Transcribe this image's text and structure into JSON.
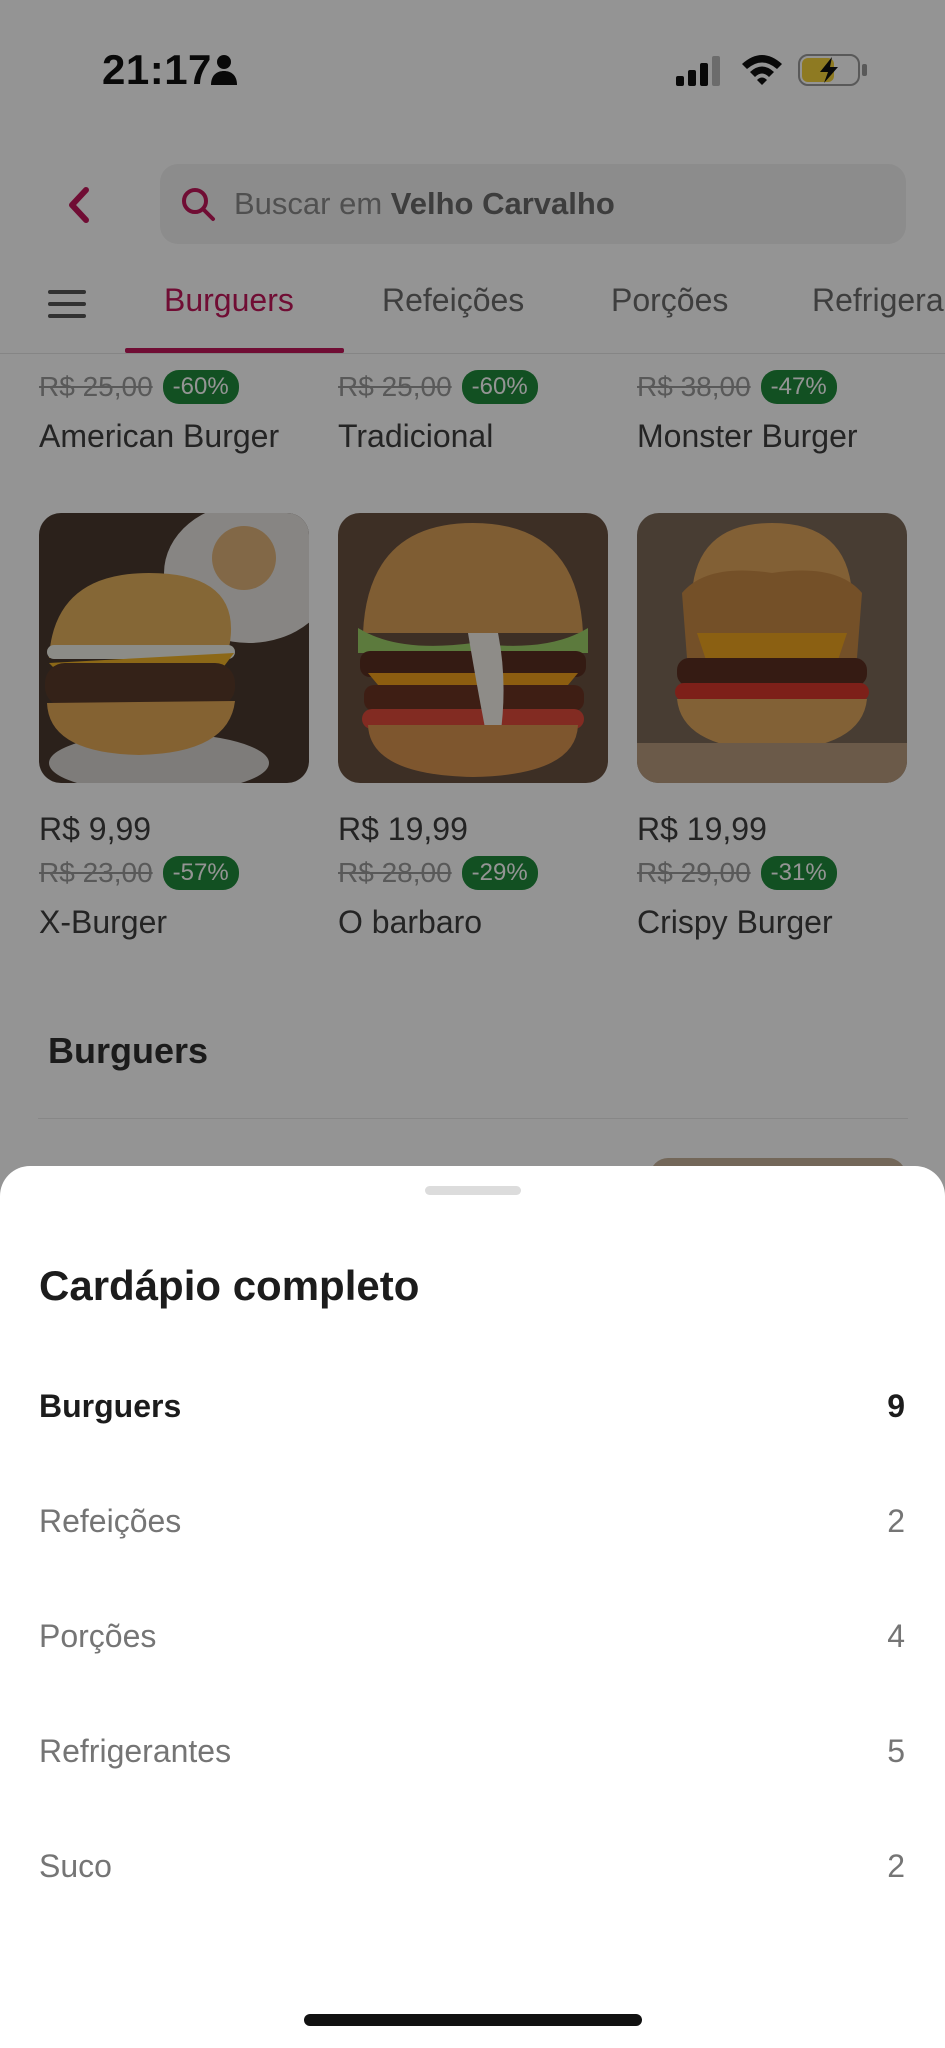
{
  "status_bar": {
    "time": "21:17"
  },
  "header": {
    "search_prefix": "Buscar em",
    "search_store": "Velho Carvalho"
  },
  "tabs": [
    {
      "label": "Burguers",
      "active": true
    },
    {
      "label": "Refeições"
    },
    {
      "label": "Porções"
    },
    {
      "label": "Refrigerantes"
    }
  ],
  "products_row1": [
    {
      "old_price": "R$ 25,00",
      "discount": "-60%",
      "name": "American Burger"
    },
    {
      "old_price": "R$ 25,00",
      "discount": "-60%",
      "name": "Tradicional"
    },
    {
      "old_price": "R$ 38,00",
      "discount": "-47%",
      "name": "Monster Burger"
    }
  ],
  "products_row2": [
    {
      "price": "R$ 9,99",
      "old_price": "R$ 23,00",
      "discount": "-57%",
      "name": "X-Burger"
    },
    {
      "price": "R$ 19,99",
      "old_price": "R$ 28,00",
      "discount": "-29%",
      "name": "O barbaro"
    },
    {
      "price": "R$ 19,99",
      "old_price": "R$ 29,00",
      "discount": "-31%",
      "name": "Crispy Burger"
    }
  ],
  "section": {
    "title": "Burguers"
  },
  "sheet": {
    "title": "Cardápio completo",
    "categories": [
      {
        "label": "Burguers",
        "count": "9",
        "active": true
      },
      {
        "label": "Refeições",
        "count": "2"
      },
      {
        "label": "Porções",
        "count": "4"
      },
      {
        "label": "Refrigerantes",
        "count": "5"
      },
      {
        "label": "Suco",
        "count": "2"
      }
    ]
  },
  "colors": {
    "accent": "#c2185b",
    "discount": "#1f8b3b",
    "overlay": "rgba(0,0,0,0.42)"
  }
}
